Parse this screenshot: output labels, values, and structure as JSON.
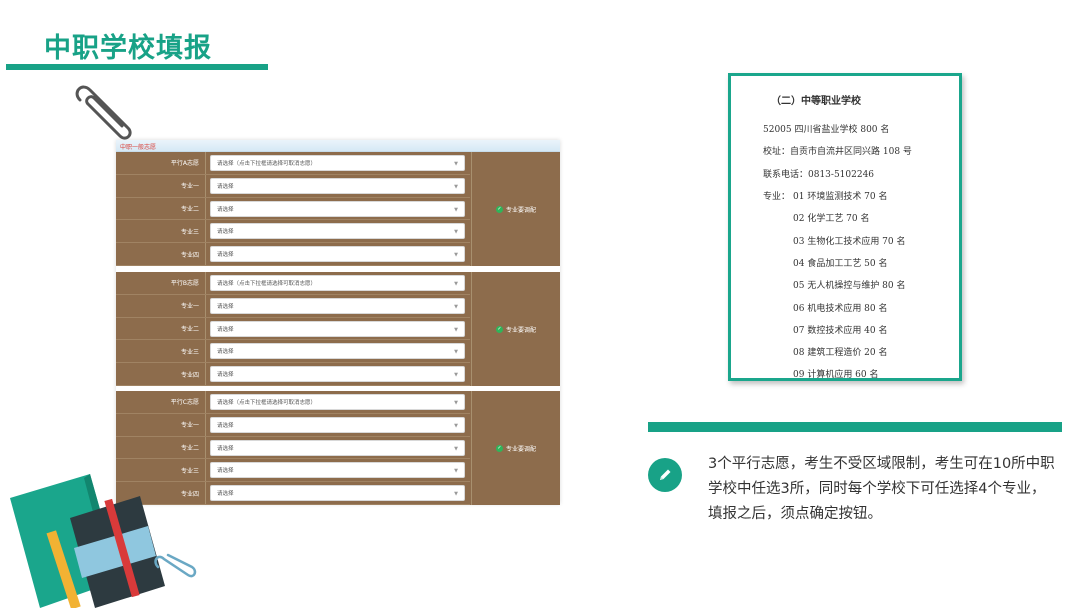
{
  "slide": {
    "title": "中职学校填报",
    "description": "3个平行志愿，考生不受区域限制，考生可在10所中职学校中任选3所，同时每个学校下可任选择4个专业，填报之后，须点确定按钮。"
  },
  "form": {
    "header": "中职一般志愿",
    "groups": [
      {
        "school_label": "平行A志愿",
        "school_placeholder": "请选择（点击下拉框请选择可取消志愿）",
        "status": "专业要调配",
        "majors": [
          {
            "label": "专业一",
            "placeholder": "请选择"
          },
          {
            "label": "专业二",
            "placeholder": "请选择"
          },
          {
            "label": "专业三",
            "placeholder": "请选择"
          },
          {
            "label": "专业四",
            "placeholder": "请选择"
          }
        ]
      },
      {
        "school_label": "平行B志愿",
        "school_placeholder": "请选择（点击下拉框请选择可取消志愿）",
        "status": "专业要调配",
        "majors": [
          {
            "label": "专业一",
            "placeholder": "请选择"
          },
          {
            "label": "专业二",
            "placeholder": "请选择"
          },
          {
            "label": "专业三",
            "placeholder": "请选择"
          },
          {
            "label": "专业四",
            "placeholder": "请选择"
          }
        ]
      },
      {
        "school_label": "平行C志愿",
        "school_placeholder": "请选择（点击下拉框请选择可取消志愿）",
        "status": "专业要调配",
        "majors": [
          {
            "label": "专业一",
            "placeholder": "请选择"
          },
          {
            "label": "专业二",
            "placeholder": "请选择"
          },
          {
            "label": "专业三",
            "placeholder": "请选择"
          },
          {
            "label": "专业四",
            "placeholder": "请选择"
          }
        ]
      }
    ]
  },
  "document": {
    "title": "（二）中等职业学校",
    "school": "52005 四川省盐业学校 800 名",
    "address": "校址：自贡市自流井区同兴路 108 号",
    "phone": "联系电话：0813-5102246",
    "majors_prefix": "专业：",
    "majors": [
      "01 环境监测技术 70 名",
      "02 化学工艺 70 名",
      "03 生物化工技术应用 70 名",
      "04 食品加工工艺 50 名",
      "05 无人机操控与维护 80 名",
      "06 机电技术应用 80 名",
      "07 数控技术应用 40 名",
      "08 建筑工程造价 20 名",
      "09 计算机应用 60 名"
    ]
  },
  "icons": {
    "pencil": "pencil-icon",
    "paperclip": "paperclip-icon",
    "books": "books-illustration",
    "check": "check-icon",
    "dropdown": "chevron-down-icon"
  },
  "colors": {
    "accent": "#18a287",
    "form_row": "#8d6c4c",
    "check": "#2fb55a"
  }
}
